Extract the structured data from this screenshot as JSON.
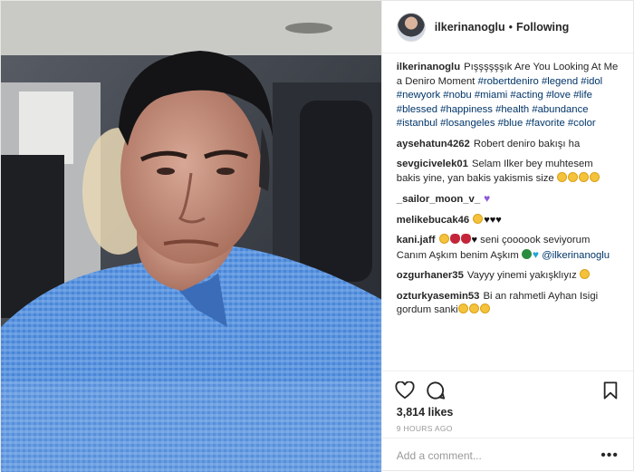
{
  "header": {
    "username": "ilkerinanoglu",
    "separator": "•",
    "follow_label": "Following"
  },
  "caption": {
    "username": "ilkerinanoglu",
    "text": "Pışşşşşşık Are You Looking At Me a Deniro Moment ",
    "hashtags": [
      "#robertdeniro",
      "#legend",
      "#idol",
      "#newyork",
      "#nobu",
      "#miami",
      "#acting",
      "#love",
      "#life",
      "#blessed",
      "#happiness",
      "#health",
      "#abundance",
      "#istanbul",
      "#losangeles",
      "#blue",
      "#favorite",
      "#color"
    ]
  },
  "comments": [
    {
      "username": "aysehatun4262",
      "text": "Robert deniro bakışı ha"
    },
    {
      "username": "sevgicivelek01",
      "text": "Selam Ilker bey muhtesem bakis yine, yan bakis yakismis size"
    },
    {
      "username": "_sailor_moon_v_",
      "text": ""
    },
    {
      "username": "melikebucak46",
      "text": ""
    },
    {
      "username": "kani.jaff",
      "text": "seni çoooook seviyorum Canım Aşkım benim Aşkım",
      "mention": "@ilkerinanoglu"
    },
    {
      "username": "ozgurhaner35",
      "text": "Vayyy yinemi yakışklıyız"
    },
    {
      "username": "ozturkyasemin53",
      "text": "Bi an rahmetli Ayhan Isigi gordum sanki"
    }
  ],
  "stats": {
    "likes": "3,814 likes",
    "time": "9 HOURS AGO"
  },
  "add_comment": {
    "placeholder": "Add a comment...",
    "more": "•••"
  },
  "icons": {
    "like": "heart-icon",
    "comment": "comment-icon",
    "save": "bookmark-icon"
  },
  "colors": {
    "shirt": "#4a86d6",
    "link": "#003569",
    "meta": "#999999"
  }
}
